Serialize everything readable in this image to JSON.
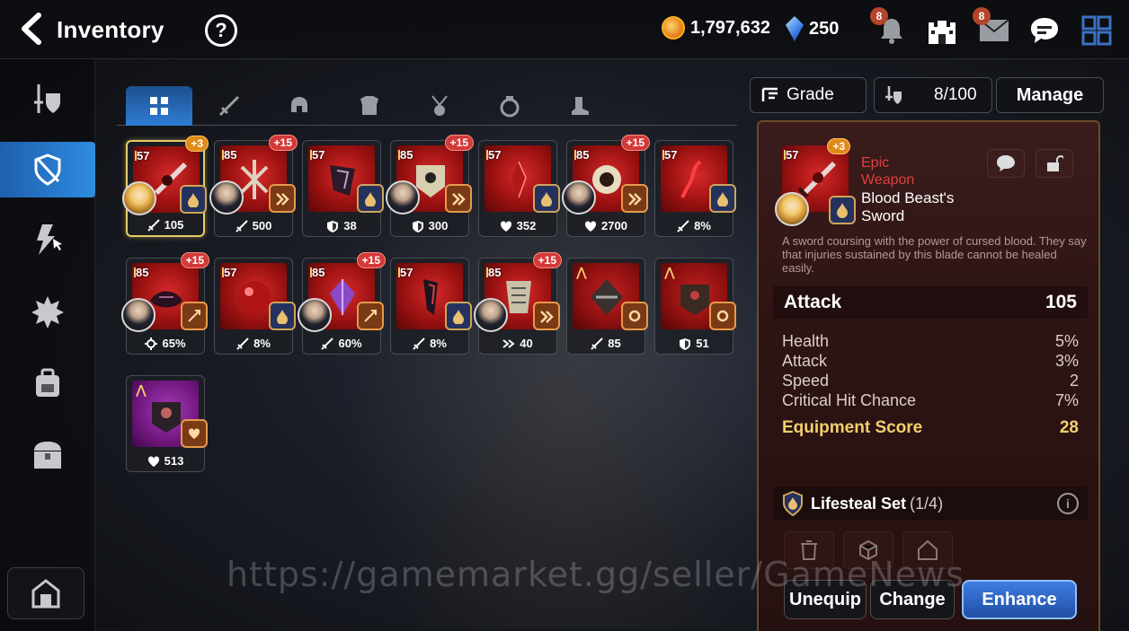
{
  "header": {
    "title": "Inventory",
    "help": "?",
    "gold": "1,797,632",
    "crystals": "250",
    "notif_bell": "8",
    "notif_mail": "8"
  },
  "tabs": [
    {
      "icon": "grid-icon"
    },
    {
      "icon": "sword-icon"
    },
    {
      "icon": "helmet-icon"
    },
    {
      "icon": "armor-icon"
    },
    {
      "icon": "necklace-icon"
    },
    {
      "icon": "ring-icon"
    },
    {
      "icon": "boots-icon"
    }
  ],
  "controls": {
    "grade": "Grade",
    "capacity": "8/100",
    "manage": "Manage"
  },
  "items": [
    {
      "level": "57",
      "plus": "+3",
      "stat_icon": "sword",
      "stat": "105",
      "hero": "blond",
      "set": "lifesteal"
    },
    {
      "level": "85",
      "plus": "+15",
      "stat_icon": "sword",
      "stat": "500",
      "hero": "dark",
      "set": "speed"
    },
    {
      "level": "57",
      "plus": "",
      "stat_icon": "shield",
      "stat": "38",
      "hero": "",
      "set": "lifesteal"
    },
    {
      "level": "85",
      "plus": "+15",
      "stat_icon": "shield",
      "stat": "300",
      "hero": "dark",
      "set": "speed"
    },
    {
      "level": "57",
      "plus": "",
      "stat_icon": "heart",
      "stat": "352",
      "hero": "",
      "set": "lifesteal"
    },
    {
      "level": "85",
      "plus": "+15",
      "stat_icon": "heart",
      "stat": "2700",
      "hero": "dark",
      "set": "speed"
    },
    {
      "level": "57",
      "plus": "",
      "stat_icon": "sword",
      "stat": "8%",
      "hero": "",
      "set": "lifesteal"
    },
    {
      "level": "85",
      "plus": "+15",
      "stat_icon": "crit",
      "stat": "65%",
      "hero": "dark",
      "set": "counter"
    },
    {
      "level": "57",
      "plus": "",
      "stat_icon": "sword",
      "stat": "8%",
      "hero": "",
      "set": "lifesteal"
    },
    {
      "level": "85",
      "plus": "+15",
      "stat_icon": "sword",
      "stat": "60%",
      "hero": "dark",
      "set": "counter"
    },
    {
      "level": "57",
      "plus": "",
      "stat_icon": "sword",
      "stat": "8%",
      "hero": "",
      "set": "lifesteal"
    },
    {
      "level": "85",
      "plus": "+15",
      "stat_icon": "speed",
      "stat": "40",
      "hero": "dark",
      "set": "speed"
    },
    {
      "level": "",
      "plus": "",
      "stat_icon": "sword",
      "stat": "85",
      "hero": "",
      "set": "gear"
    },
    {
      "level": "",
      "plus": "",
      "stat_icon": "shield",
      "stat": "51",
      "hero": "",
      "set": "gear"
    },
    {
      "level": "",
      "plus": "",
      "stat_icon": "heart",
      "stat": "513",
      "hero": "",
      "set": "heart"
    }
  ],
  "detail": {
    "level": "57",
    "plus": "+3",
    "rarity": "Epic",
    "type": "Weapon",
    "name": "Blood Beast's Sword",
    "description": "A sword coursing with the power of cursed blood. They say that injuries sustained by this blade cannot be healed easily.",
    "main_stat": {
      "label": "Attack",
      "value": "105"
    },
    "substats": [
      {
        "label": "Health",
        "value": "5%"
      },
      {
        "label": "Attack",
        "value": "3%"
      },
      {
        "label": "Speed",
        "value": "2"
      },
      {
        "label": "Critical Hit Chance",
        "value": "7%"
      }
    ],
    "score": {
      "label": "Equipment Score",
      "value": "28"
    },
    "set": {
      "name": "Lifesteal Set",
      "count": "(1/4)"
    },
    "buttons": {
      "unequip": "Unequip",
      "change": "Change",
      "enhance": "Enhance"
    }
  },
  "watermark": "https://gamemarket.gg/seller/GameNews",
  "colors": {
    "accent": "#2f7dd6",
    "selected": "#e6cc6a",
    "epic_red": "#e0413b",
    "score_gold": "#f1d06f"
  }
}
